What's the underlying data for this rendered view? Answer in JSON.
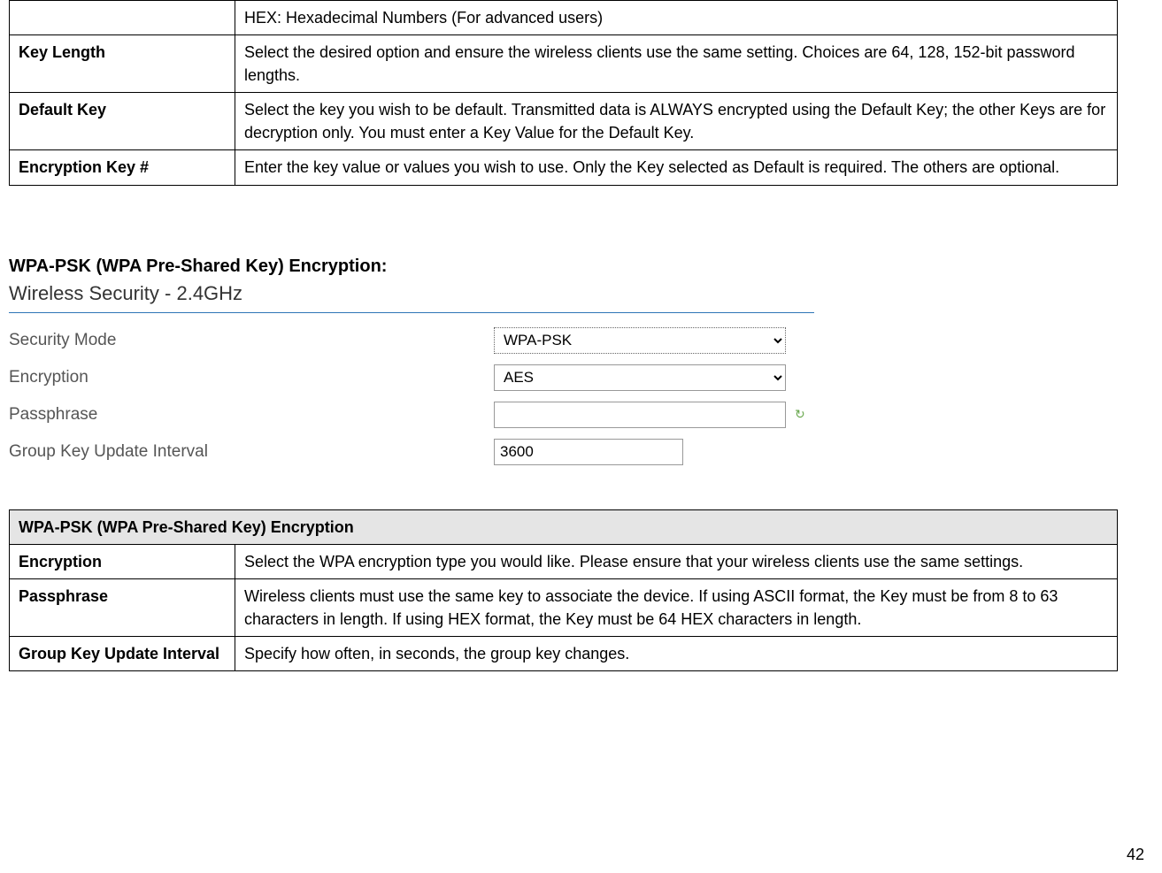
{
  "table1": {
    "rows": [
      {
        "key": "",
        "val": "HEX: Hexadecimal Numbers (For advanced users)"
      },
      {
        "key": "Key Length",
        "val": "Select the desired option and ensure the wireless clients use the same setting. Choices are 64, 128, 152-bit password lengths."
      },
      {
        "key": "Default Key",
        "val": "Select the key you wish to be default. Transmitted data is ALWAYS encrypted using the Default Key; the other Keys are for decryption only.  You must enter a Key Value for the Default Key."
      },
      {
        "key": "Encryption Key #",
        "val": "Enter the key value or values you wish to use. Only the Key selected as Default is required. The others are optional."
      }
    ]
  },
  "section_heading": "WPA-PSK (WPA Pre-Shared Key) Encryption:",
  "panel": {
    "title": "Wireless Security - 2.4GHz",
    "rows": {
      "security_mode": {
        "label": "Security Mode",
        "value": "WPA-PSK"
      },
      "encryption": {
        "label": "Encryption",
        "value": "AES"
      },
      "passphrase": {
        "label": "Passphrase",
        "value": ""
      },
      "group_key": {
        "label": "Group Key Update Interval",
        "value": "3600"
      }
    }
  },
  "icons": {
    "refresh": "↻"
  },
  "table2": {
    "header": "WPA-PSK (WPA Pre-Shared Key) Encryption",
    "rows": [
      {
        "key": "Encryption",
        "val": "Select the WPA encryption type you would like. Please ensure that your wireless clients use the same settings."
      },
      {
        "key": "Passphrase",
        "val": "Wireless clients must use the same key to associate the device. If using ASCII format, the Key must be from 8 to 63 characters in length. If using HEX format, the Key must be 64 HEX characters in length."
      },
      {
        "key": "Group Key Update Interval",
        "val": "Specify how often, in seconds, the group key changes."
      }
    ]
  },
  "page_number": "42"
}
